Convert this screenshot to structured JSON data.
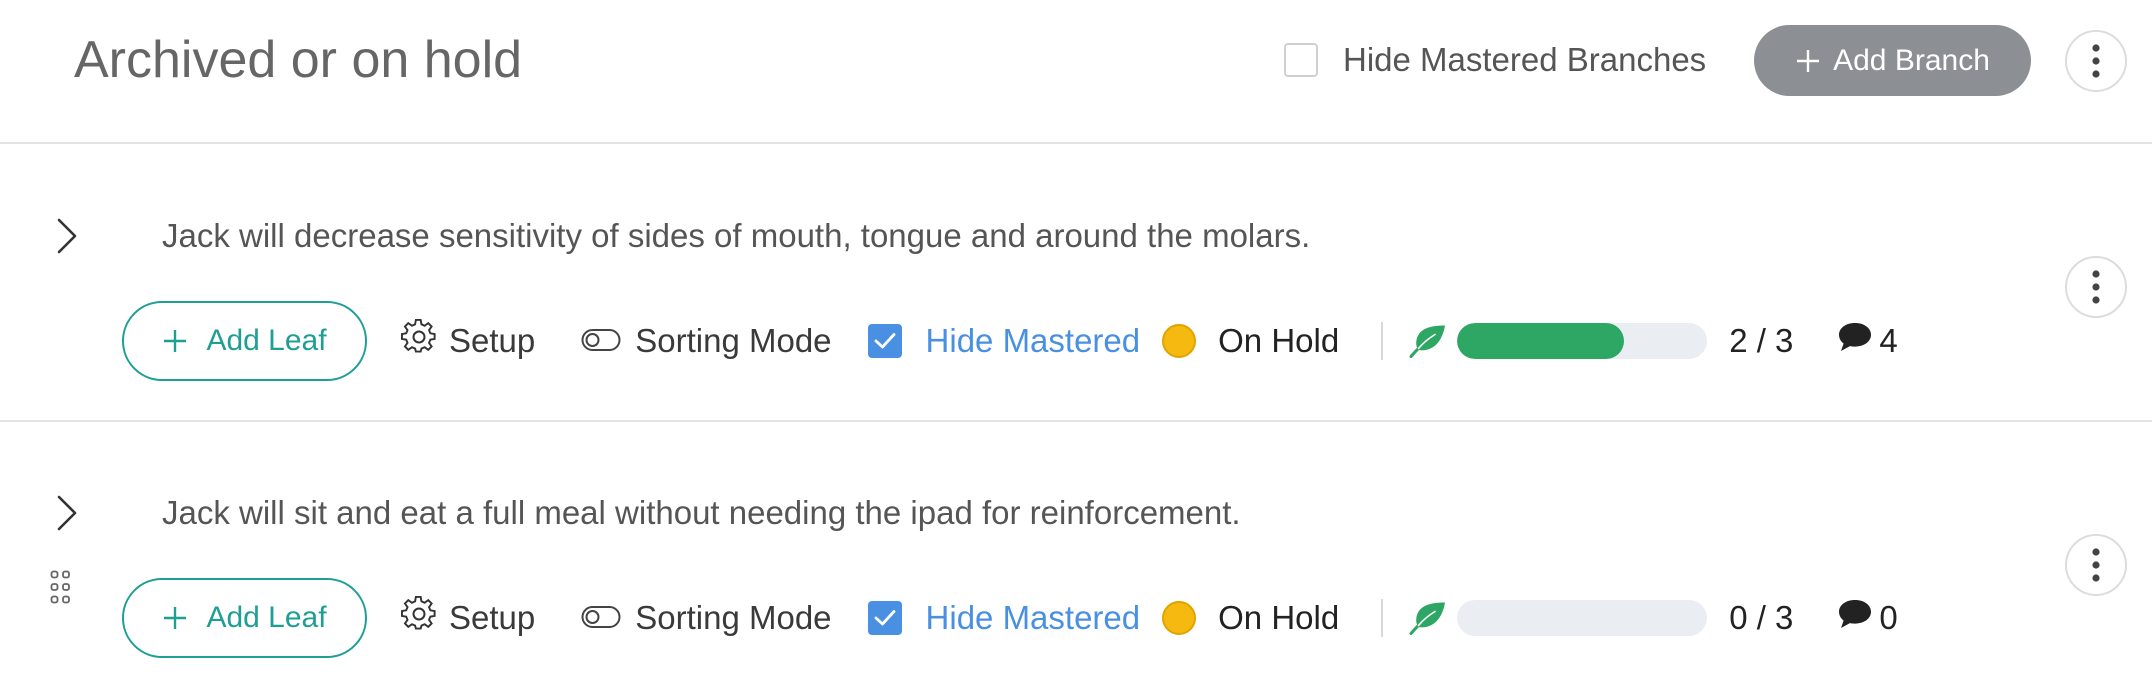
{
  "header": {
    "title": "Archived or on hold",
    "hide_mastered_branches_label": "Hide Mastered Branches",
    "hide_mastered_branches_checked": false,
    "add_branch_label": "Add Branch"
  },
  "goals": [
    {
      "text": "Jack will decrease sensitivity of sides of mouth, tongue and around the molars.",
      "add_leaf_label": "Add Leaf",
      "setup_label": "Setup",
      "sorting_label": "Sorting Mode",
      "hide_mastered_label": "Hide Mastered",
      "hide_mastered_checked": true,
      "status_label": "On Hold",
      "status_color": "#f5b90f",
      "progress_fraction": 0.6667,
      "progress_text": "2 / 3",
      "comment_count": "4"
    },
    {
      "text": "Jack will sit and eat a full meal without needing the ipad for reinforcement.",
      "add_leaf_label": "Add Leaf",
      "setup_label": "Setup",
      "sorting_label": "Sorting Mode",
      "hide_mastered_label": "Hide Mastered",
      "hide_mastered_checked": true,
      "status_label": "On Hold",
      "status_color": "#f5b90f",
      "progress_fraction": 0,
      "progress_text": "0 / 3",
      "comment_count": "0"
    }
  ],
  "colors": {
    "accent_teal": "#1f9e93",
    "link_blue": "#4a90e2",
    "progress_green": "#2fa764",
    "leaf_green": "#2fa764",
    "button_gray": "#8c8f93"
  },
  "icons": [
    "chevron-right-icon",
    "gear-icon",
    "toggle-icon",
    "checkbox-checked-icon",
    "leaf-icon",
    "comment-icon",
    "kebab-icon",
    "plus-icon",
    "drag-handle-icon"
  ]
}
